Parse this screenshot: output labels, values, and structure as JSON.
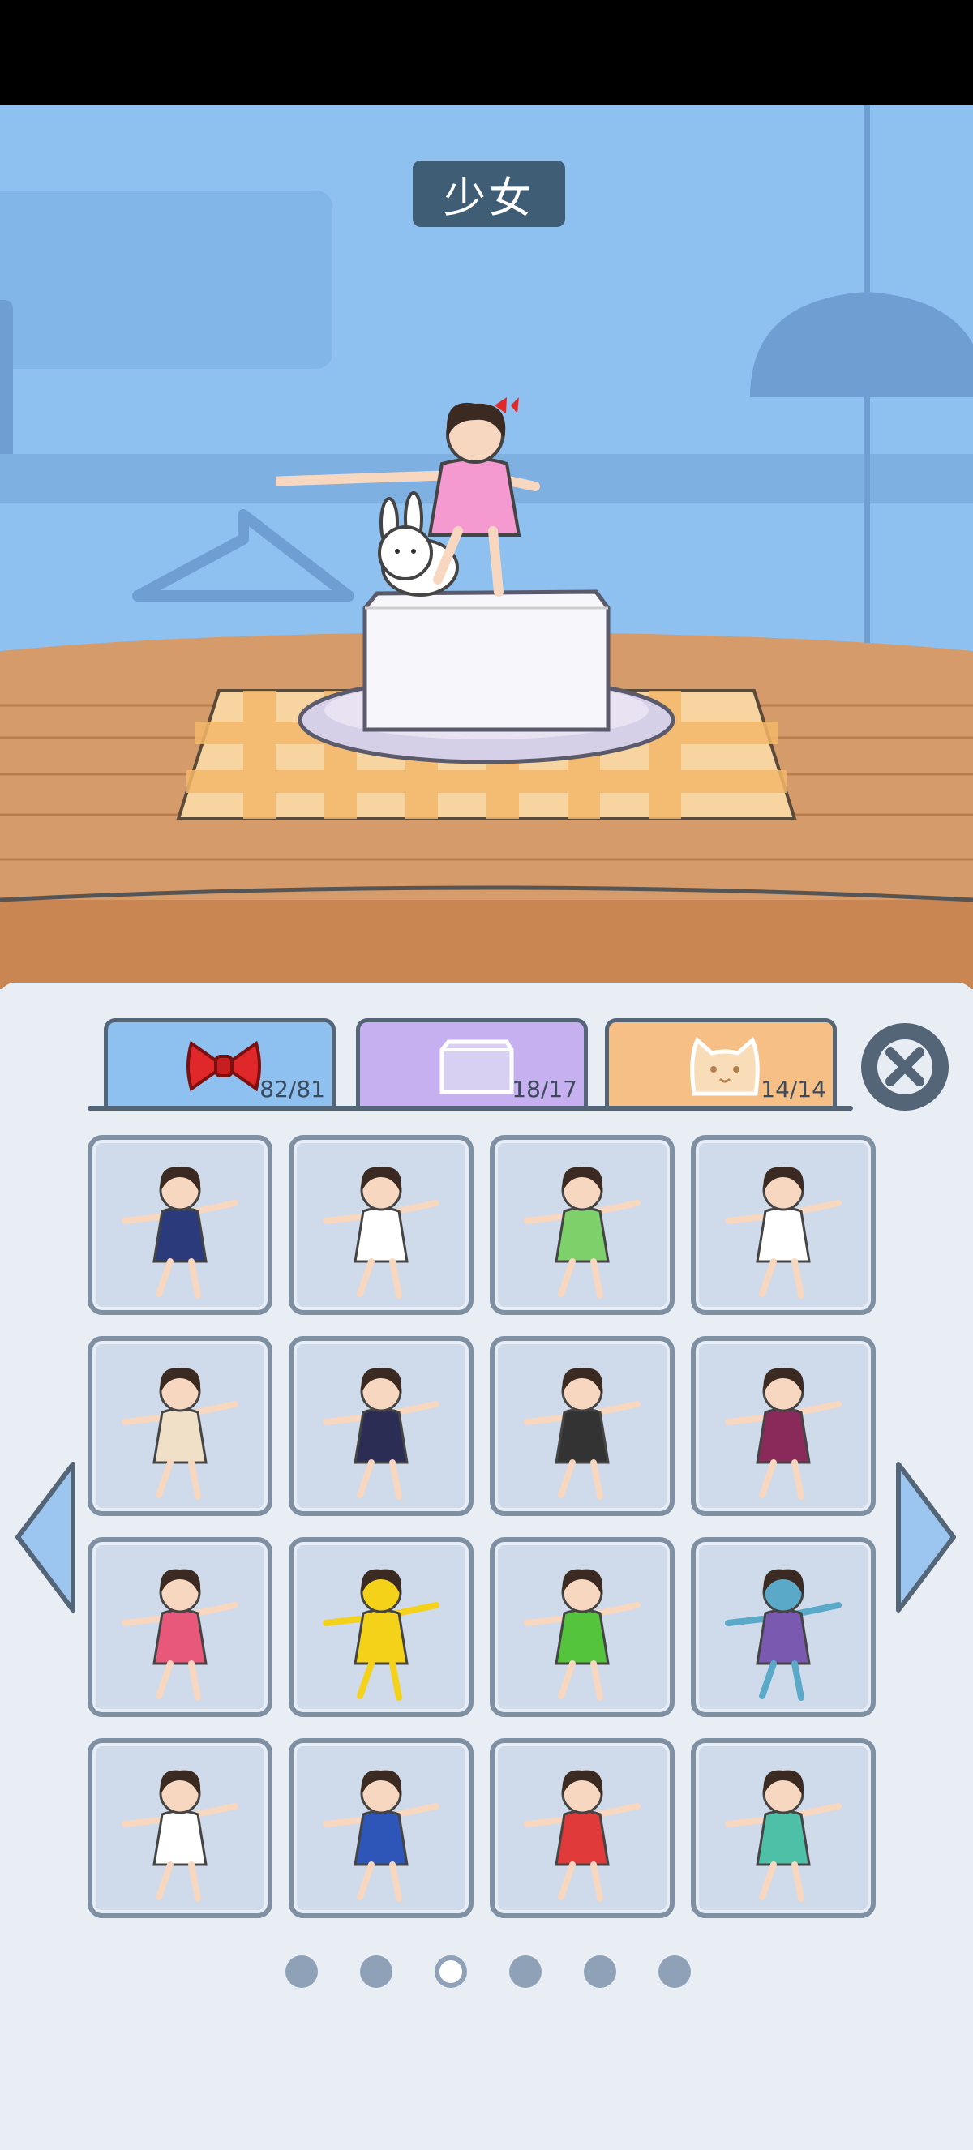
{
  "scene": {
    "title": "少女"
  },
  "tabs": [
    {
      "icon": "ribbon-bow-icon",
      "count": "82/81",
      "color": "#8ec0f0"
    },
    {
      "icon": "tofu-block-icon",
      "count": "18/17",
      "color": "#c6b0f0"
    },
    {
      "icon": "cat-face-icon",
      "count": "14/14",
      "color": "#f5bf85"
    }
  ],
  "close_icon": "close-x-icon",
  "grid": {
    "rows": 4,
    "cols": 4,
    "items": [
      {
        "icon": "sailor-uniform-girl-icon",
        "accent": "#2a3a7a",
        "skin": "#f7d7c0"
      },
      {
        "icon": "tofu-costume-girl-icon",
        "accent": "#ffffff",
        "skin": "#f7d7c0"
      },
      {
        "icon": "bok-choy-costume-icon",
        "accent": "#7ed06a",
        "skin": "#f7d7c0"
      },
      {
        "icon": "crane-costume-icon",
        "accent": "#ffffff",
        "skin": "#f7d7c0"
      },
      {
        "icon": "casual-skirt-girl-icon",
        "accent": "#f0e0c8",
        "skin": "#f7d7c0"
      },
      {
        "icon": "tracksuit-girl-icon",
        "accent": "#2b2d55",
        "skin": "#f7d7c0"
      },
      {
        "icon": "maid-with-broom-icon",
        "accent": "#333333",
        "skin": "#f7d7c0"
      },
      {
        "icon": "hakama-girl-icon",
        "accent": "#8a2a5a",
        "skin": "#f7d7c0"
      },
      {
        "icon": "fan-coat-girl-icon",
        "accent": "#e8587a",
        "skin": "#f7d7c0"
      },
      {
        "icon": "golden-girl-icon",
        "accent": "#f5d21a",
        "skin": "#f5d21a"
      },
      {
        "icon": "frog-costume-icon",
        "accent": "#53c43c",
        "skin": "#f7d7c0"
      },
      {
        "icon": "blue-oni-girl-icon",
        "accent": "#7a5ab0",
        "skin": "#5aa9c9"
      },
      {
        "icon": "chef-octopus-icon",
        "accent": "#ffffff",
        "skin": "#f7d7c0"
      },
      {
        "icon": "blue-tracksuit-girl-icon",
        "accent": "#2e55b8",
        "skin": "#f7d7c0"
      },
      {
        "icon": "chef-whisk-girl-icon",
        "accent": "#e03a3a",
        "skin": "#f7d7c0"
      },
      {
        "icon": "painter-beret-girl-icon",
        "accent": "#4fc0a8",
        "skin": "#f7d7c0"
      }
    ]
  },
  "nav": {
    "prev_icon": "arrow-left-icon",
    "next_icon": "arrow-right-icon"
  },
  "pagination": {
    "total": 6,
    "current": 3
  }
}
